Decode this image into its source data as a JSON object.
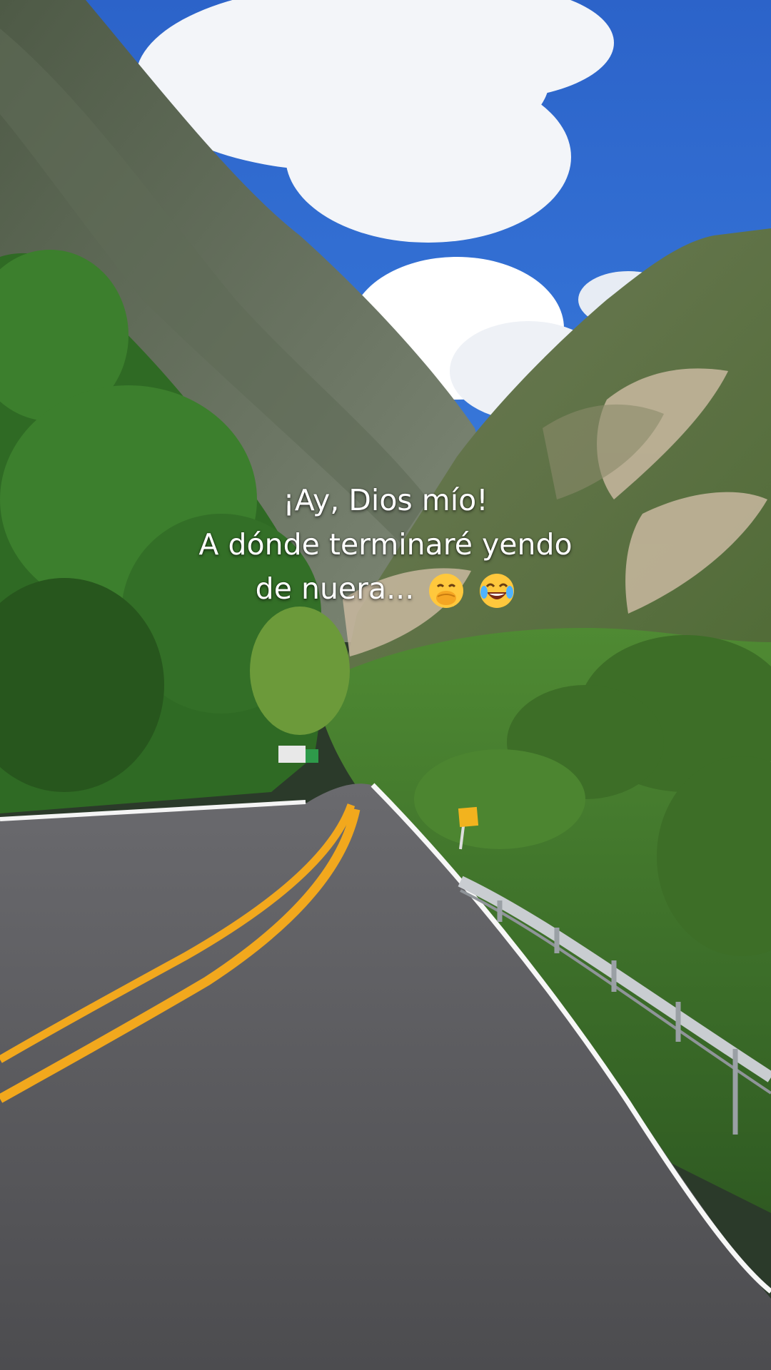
{
  "caption": {
    "line1": "¡Ay, Dios mío!",
    "line2": "A dónde terminaré yendo",
    "line3": "de nuera..."
  },
  "emojis": [
    "face-with-hand-over-mouth-icon",
    "face-with-tears-of-joy-icon"
  ],
  "colors": {
    "sky": "#2f6fd4",
    "cloud": "#f4f6fa",
    "mountain": "#5d6b55",
    "vegetation": "#3f7a2c",
    "road": "#5a5a5c",
    "center_line": "#f2a81d",
    "edge_line": "#ffffff"
  }
}
